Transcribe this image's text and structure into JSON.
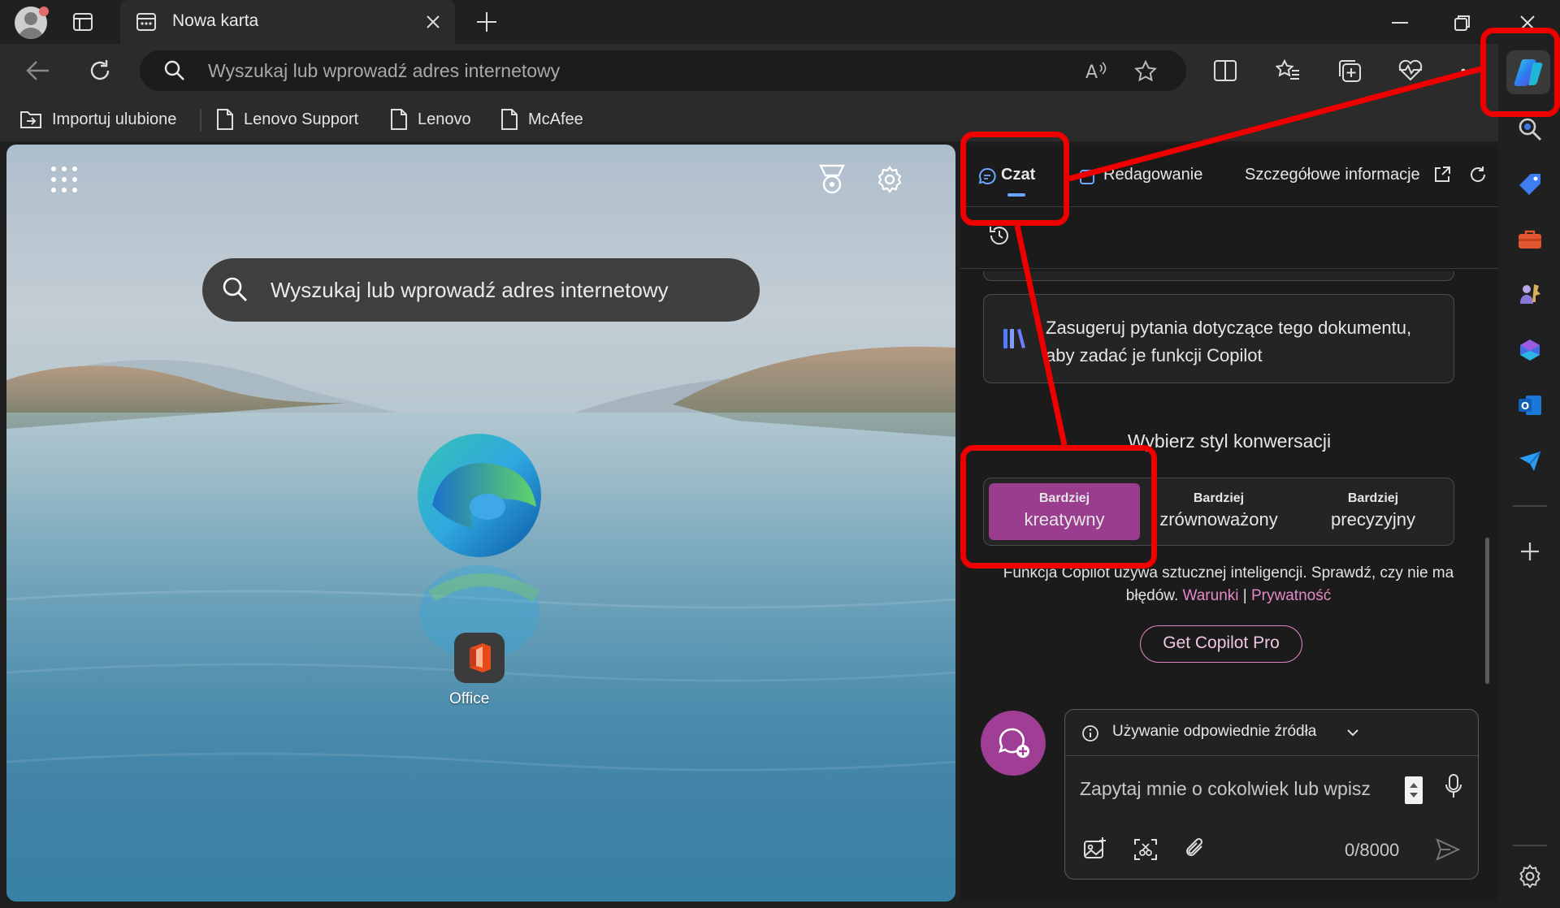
{
  "browser": {
    "tab_title": "Nowa karta",
    "address_placeholder": "Wyszukaj lub wprowadź adres internetowy",
    "favorites": [
      "Importuj ulubione",
      "Lenovo Support",
      "Lenovo",
      "McAfee"
    ]
  },
  "newtab": {
    "search_placeholder": "Wyszukaj lub wprowadź adres internetowy",
    "app_label": "Office"
  },
  "copilot": {
    "tabs": {
      "chat": "Czat",
      "compose": "Redagowanie",
      "insights": "Szczegółowe informacje"
    },
    "suggest_card": "Zasugeruj pytania dotyczące tego dokumentu, aby zadać je funkcji Copilot",
    "style_title": "Wybierz styl konwersacji",
    "styles": [
      {
        "top": "Bardziej",
        "bottom": "kreatywny",
        "selected": true
      },
      {
        "top": "Bardziej",
        "bottom": "zrównoważony",
        "selected": false
      },
      {
        "top": "Bardziej",
        "bottom": "precyzyjny",
        "selected": false
      }
    ],
    "disclaimer": "Funkcja Copilot używa sztucznej inteligencji. Sprawdź, czy nie ma błędów.",
    "terms_link": "Warunki",
    "separator": "|",
    "privacy_link": "Prywatność",
    "pro_button": "Get Copilot Pro",
    "sources_label": "Używanie odpowiednie źródła",
    "input_placeholder": "Zapytaj mnie o cokolwiek lub wpisz",
    "char_counter": "0/8000"
  },
  "colors": {
    "accent": "#9b3d8f",
    "annotation": "#ee0000",
    "link": "#e58ac9"
  }
}
